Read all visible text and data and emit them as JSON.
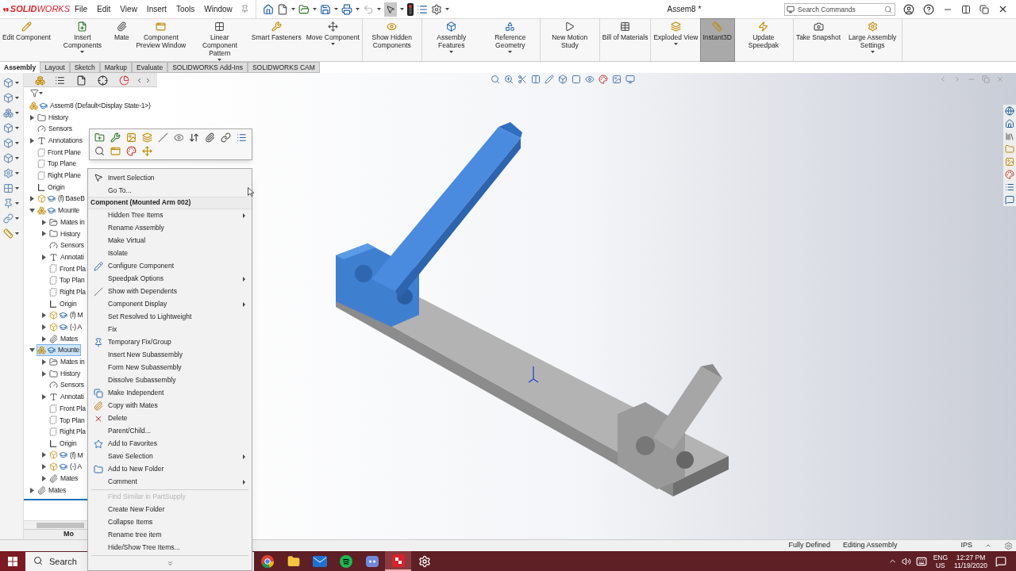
{
  "title_bar": {
    "logo": "**SOLID**WORKS",
    "menus": [
      "File",
      "Edit",
      "View",
      "Insert",
      "Tools",
      "Window"
    ],
    "title": "Assem8 *",
    "search": {
      "placeholder": "Search Commands"
    }
  },
  "ribbon": {
    "groups": [
      [
        {
          "label": "Edit Component",
          "dropdown": false,
          "selected": false
        },
        {
          "label": "Insert Components",
          "dropdown": true,
          "selected": false
        },
        {
          "label": "Mate",
          "dropdown": false,
          "selected": false
        },
        {
          "label": "Component Preview Window",
          "dropdown": false,
          "selected": false
        },
        {
          "label": "Linear Component Pattern",
          "dropdown": true,
          "selected": false
        },
        {
          "label": "Smart Fasteners",
          "dropdown": false,
          "selected": false
        },
        {
          "label": "Move Component",
          "dropdown": true,
          "selected": false
        }
      ],
      [
        {
          "label": "Show Hidden Components",
          "dropdown": false,
          "selected": false
        }
      ],
      [
        {
          "label": "Assembly Features",
          "dropdown": true,
          "selected": false
        },
        {
          "label": "Reference Geometry",
          "dropdown": true,
          "selected": false
        }
      ],
      [
        {
          "label": "New Motion Study",
          "dropdown": false,
          "selected": false
        }
      ],
      [
        {
          "label": "Bill of Materials",
          "dropdown": false,
          "selected": false
        }
      ],
      [
        {
          "label": "Exploded View",
          "dropdown": true,
          "selected": false
        },
        {
          "label": "Instant3D",
          "dropdown": false,
          "selected": true
        },
        {
          "label": "Update Speedpak",
          "dropdown": false,
          "selected": false
        }
      ],
      [
        {
          "label": "Take Snapshot",
          "dropdown": false,
          "selected": false
        },
        {
          "label": "Large Assembly Settings",
          "dropdown": true,
          "selected": false
        }
      ]
    ]
  },
  "tabs": [
    {
      "label": "Assembly",
      "selected": true
    },
    {
      "label": "Layout",
      "selected": false
    },
    {
      "label": "Sketch",
      "selected": false
    },
    {
      "label": "Markup",
      "selected": false
    },
    {
      "label": "Evaluate",
      "selected": false
    },
    {
      "label": "SOLIDWORKS Add-Ins",
      "selected": false
    },
    {
      "label": "SOLIDWORKS CAM",
      "selected": false
    }
  ],
  "tree": {
    "label": "Assem8  (Default<Display State-1>)",
    "kind": "assembly",
    "selected": false,
    "children": [
      {
        "label": "History",
        "kind": "history",
        "expanded": false,
        "selected": false
      },
      {
        "label": "Sensors",
        "kind": "sensors",
        "selected": false
      },
      {
        "label": "Annotations",
        "kind": "annotations",
        "expanded": false,
        "selected": false
      },
      {
        "label": "Front Plane",
        "kind": "plane",
        "selected": false
      },
      {
        "label": "Top Plane",
        "kind": "plane",
        "selected": false
      },
      {
        "label": "Right Plane",
        "kind": "plane",
        "selected": false
      },
      {
        "label": "Origin",
        "kind": "origin",
        "selected": false
      },
      {
        "label": "(f) BaseB",
        "kind": "part",
        "expanded": false,
        "selected": false
      },
      {
        "label": "Mounte",
        "kind": "assembly",
        "expanded": true,
        "selected": false,
        "children": [
          {
            "label": "Mates in",
            "kind": "mates-in",
            "expanded": false,
            "selected": false
          },
          {
            "label": "History",
            "kind": "history",
            "expanded": false,
            "selected": false
          },
          {
            "label": "Sensors",
            "kind": "sensors",
            "selected": false
          },
          {
            "label": "Annotati",
            "kind": "annotations",
            "expanded": false,
            "selected": false
          },
          {
            "label": "Front Pla",
            "kind": "plane",
            "selected": false
          },
          {
            "label": "Top Plan",
            "kind": "plane",
            "selected": false
          },
          {
            "label": "Right Pla",
            "kind": "plane",
            "selected": false
          },
          {
            "label": "Origin",
            "kind": "origin",
            "selected": false
          },
          {
            "label": "(f) M",
            "kind": "part",
            "expanded": false,
            "selected": false
          },
          {
            "label": "(-) A",
            "kind": "part",
            "expanded": false,
            "selected": false
          },
          {
            "label": "Mates",
            "kind": "mates",
            "expanded": false,
            "selected": false
          }
        ]
      },
      {
        "label": "Mounte",
        "kind": "assembly",
        "expanded": true,
        "selected": true,
        "children": [
          {
            "label": "Mates in",
            "kind": "mates-in",
            "expanded": false,
            "selected": false
          },
          {
            "label": "History",
            "kind": "history",
            "expanded": false,
            "selected": false
          },
          {
            "label": "Sensors",
            "kind": "sensors",
            "selected": false
          },
          {
            "label": "Annotati",
            "kind": "annotations",
            "expanded": false,
            "selected": false
          },
          {
            "label": "Front Pla",
            "kind": "plane",
            "selected": false
          },
          {
            "label": "Top Plan",
            "kind": "plane",
            "selected": false
          },
          {
            "label": "Right Pla",
            "kind": "plane",
            "selected": false
          },
          {
            "label": "Origin",
            "kind": "origin",
            "selected": false
          },
          {
            "label": "(f) M",
            "kind": "part",
            "expanded": false,
            "selected": false
          },
          {
            "label": "(-) A",
            "kind": "part",
            "expanded": false,
            "selected": false
          },
          {
            "label": "Mates",
            "kind": "mates",
            "expanded": false,
            "selected": false
          }
        ]
      },
      {
        "label": "Mates",
        "kind": "mates",
        "expanded": false,
        "selected": false
      }
    ]
  },
  "bottom_tab": "Mo",
  "context_menu": {
    "items": [
      {
        "kind": "item",
        "label": "Invert Selection",
        "submenu": false,
        "disabled": false
      },
      {
        "kind": "item",
        "label": "Go To...",
        "submenu": false,
        "disabled": false
      },
      {
        "kind": "header",
        "label": "Component (Mounted Arm 002)"
      },
      {
        "kind": "item",
        "label": "Hidden Tree Items",
        "submenu": true,
        "disabled": false
      },
      {
        "kind": "item",
        "label": "Rename Assembly",
        "submenu": false,
        "disabled": false
      },
      {
        "kind": "item",
        "label": "Make Virtual",
        "submenu": false,
        "disabled": false
      },
      {
        "kind": "item",
        "label": "Isolate",
        "submenu": false,
        "disabled": false
      },
      {
        "kind": "item",
        "label": "Configure Component",
        "submenu": false,
        "disabled": false
      },
      {
        "kind": "item",
        "label": "Speedpak Options",
        "submenu": true,
        "disabled": false
      },
      {
        "kind": "item",
        "label": "Show with Dependents",
        "submenu": false,
        "disabled": false
      },
      {
        "kind": "item",
        "label": "Component Display",
        "submenu": true,
        "disabled": false
      },
      {
        "kind": "item",
        "label": "Set Resolved to Lightweight",
        "submenu": false,
        "disabled": false
      },
      {
        "kind": "item",
        "label": "Fix",
        "submenu": false,
        "disabled": false
      },
      {
        "kind": "item",
        "label": "Temporary Fix/Group",
        "submenu": false,
        "disabled": false
      },
      {
        "kind": "item",
        "label": "Insert New Subassembly",
        "submenu": false,
        "disabled": false
      },
      {
        "kind": "item",
        "label": "Form New Subassembly",
        "submenu": false,
        "disabled": false
      },
      {
        "kind": "item",
        "label": "Dissolve Subassembly",
        "submenu": false,
        "disabled": false
      },
      {
        "kind": "item",
        "label": "Make Independent",
        "submenu": false,
        "disabled": false
      },
      {
        "kind": "item",
        "label": "Copy with Mates",
        "submenu": false,
        "disabled": false
      },
      {
        "kind": "item",
        "label": "Delete",
        "submenu": false,
        "disabled": false
      },
      {
        "kind": "item",
        "label": "Parent/Child...",
        "submenu": false,
        "disabled": false
      },
      {
        "kind": "item",
        "label": "Add to Favorites",
        "submenu": false,
        "disabled": false
      },
      {
        "kind": "item",
        "label": "Save Selection",
        "submenu": true,
        "disabled": false
      },
      {
        "kind": "item",
        "label": "Add to New Folder",
        "submenu": false,
        "disabled": false
      },
      {
        "kind": "item",
        "label": "Comment",
        "submenu": true,
        "disabled": false
      },
      {
        "kind": "separator"
      },
      {
        "kind": "item",
        "label": "Find Similar in PartSupply",
        "submenu": false,
        "disabled": true
      },
      {
        "kind": "item",
        "label": "Create New Folder",
        "submenu": false,
        "disabled": false
      },
      {
        "kind": "item",
        "label": "Collapse Items",
        "submenu": false,
        "disabled": false
      },
      {
        "kind": "item",
        "label": "Rename tree item",
        "submenu": false,
        "disabled": false
      },
      {
        "kind": "item",
        "label": "Hide/Show Tree Items...",
        "submenu": false,
        "disabled": false
      },
      {
        "kind": "separator"
      },
      {
        "kind": "more"
      }
    ]
  },
  "status_bar": {
    "state": "Fully Defined",
    "mode": "Editing Assembly",
    "units": "IPS"
  },
  "taskbar": {
    "search": {
      "placeholder": "Search"
    },
    "apps": [
      {
        "kind": "browser",
        "active": false
      },
      {
        "kind": "files",
        "active": false
      },
      {
        "kind": "mail",
        "active": false
      },
      {
        "kind": "music",
        "active": false
      },
      {
        "kind": "chat",
        "active": false
      },
      {
        "kind": "cad",
        "active": true
      },
      {
        "kind": "tool",
        "active": false
      }
    ],
    "language": "ENG",
    "region": "US",
    "time": "12:27 PM",
    "date": "11/19/2020"
  }
}
